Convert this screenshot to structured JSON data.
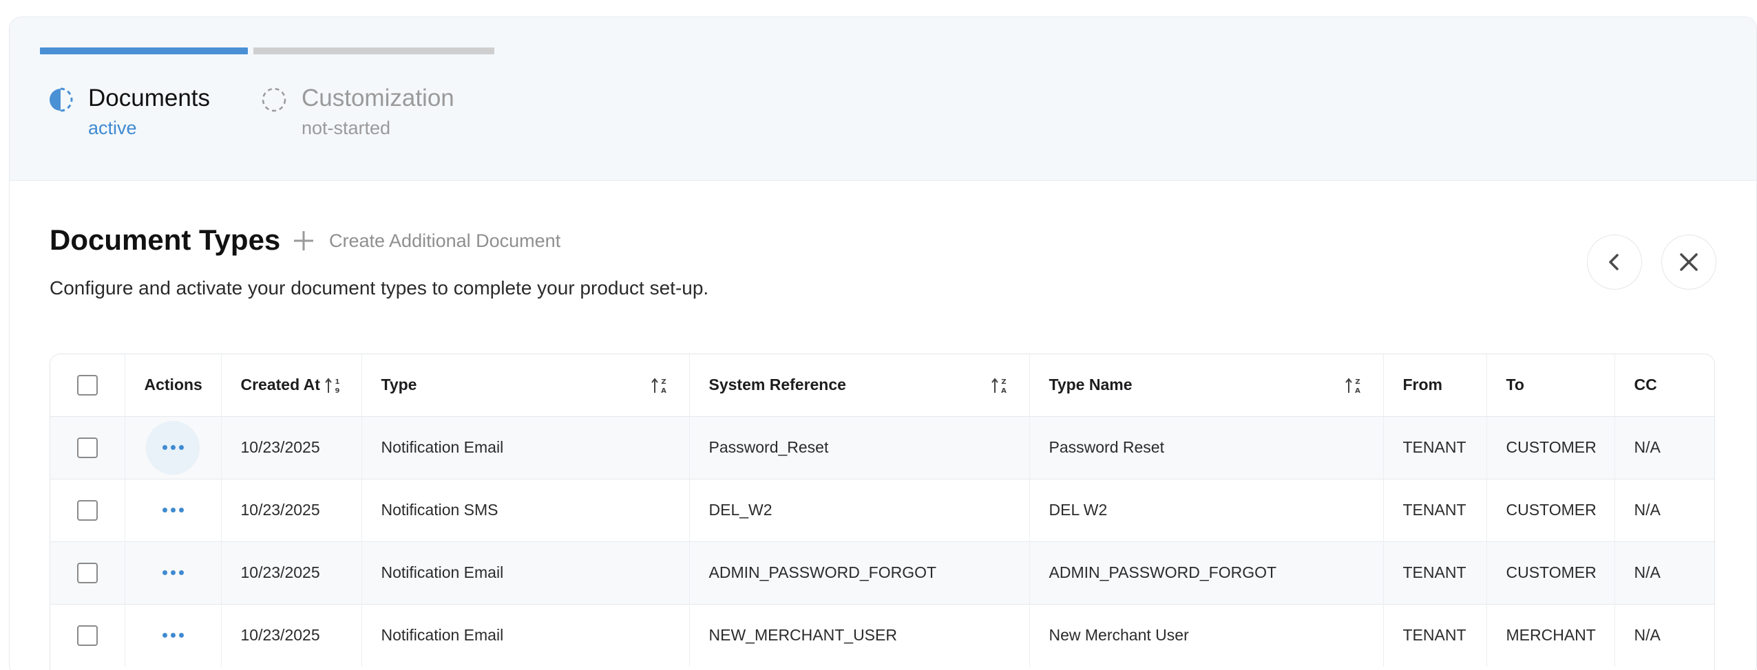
{
  "stepper": {
    "steps": [
      {
        "title": "Documents",
        "status": "active"
      },
      {
        "title": "Customization",
        "status": "not-started"
      }
    ]
  },
  "header": {
    "title": "Document Types",
    "create_label": "Create Additional Document",
    "subtitle": "Configure and activate your document types to complete your product set-up."
  },
  "table": {
    "columns": [
      "Actions",
      "Created At",
      "Type",
      "System Reference",
      "Type Name",
      "From",
      "To",
      "CC"
    ],
    "rows": [
      {
        "created_at": "10/23/2025",
        "type": "Notification Email",
        "system_reference": "Password_Reset",
        "type_name": "Password Reset",
        "from": "TENANT",
        "to": "CUSTOMER",
        "cc": "N/A"
      },
      {
        "created_at": "10/23/2025",
        "type": "Notification SMS",
        "system_reference": "DEL_W2",
        "type_name": "DEL W2",
        "from": "TENANT",
        "to": "CUSTOMER",
        "cc": "N/A"
      },
      {
        "created_at": "10/23/2025",
        "type": "Notification Email",
        "system_reference": "ADMIN_PASSWORD_FORGOT",
        "type_name": "ADMIN_PASSWORD_FORGOT",
        "from": "TENANT",
        "to": "CUSTOMER",
        "cc": "N/A"
      },
      {
        "created_at": "10/23/2025",
        "type": "Notification Email",
        "system_reference": "NEW_MERCHANT_USER",
        "type_name": "New Merchant User",
        "from": "TENANT",
        "to": "MERCHANT",
        "cc": "N/A"
      }
    ]
  },
  "colors": {
    "accent": "#4a90d4",
    "inactive": "#cfcfcf",
    "stepper_bg": "#f4f8fb"
  },
  "icons": {
    "step_active": "half-filled-circle-icon",
    "step_pending": "dashed-circle-icon",
    "create": "plus-icon",
    "back": "chevron-left-icon",
    "close": "close-icon",
    "row_actions": "more-horizontal-icon",
    "sort_numeric": "sort-numeric-icon",
    "sort_alpha": "sort-alpha-icon"
  }
}
